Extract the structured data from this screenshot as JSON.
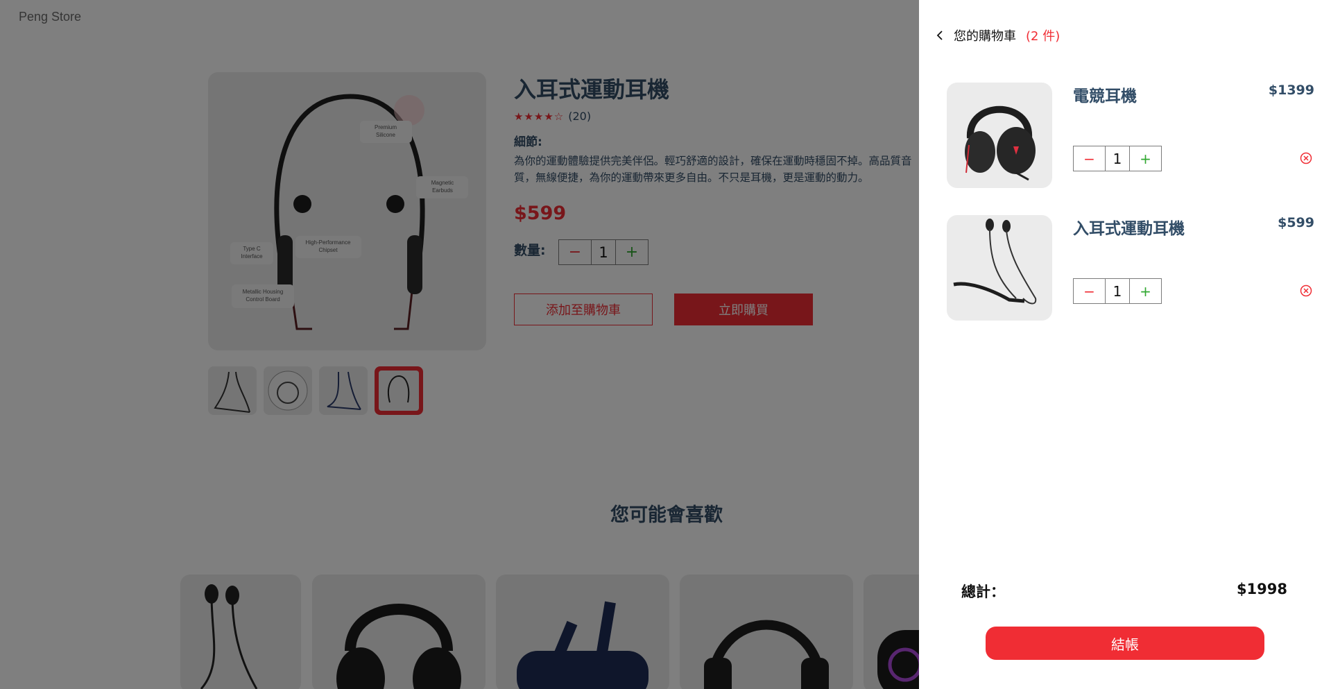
{
  "brand": "Peng Store",
  "product": {
    "title": "入耳式運動耳機",
    "rating_count": "(20)",
    "rating": 4,
    "details_heading": "細節:",
    "description": "為你的運動體驗提供完美伴侶。輕巧舒適的設計，確保在運動時穩固不掉。高品質音質，無線便捷，為你的運動帶來更多自由。不只是耳機，更是運動的動力。",
    "price": "$599",
    "quantity_label": "數量:",
    "quantity": "1",
    "add_to_cart": "添加至購物車",
    "buy_now": "立即購買",
    "image_callouts": [
      "Premium Silicone",
      "Magnetic Earbuds",
      "Type C Interface",
      "High-Performance Chipset",
      "Metallic Housing Control Board"
    ]
  },
  "recommendations_title": "您可能會喜歡",
  "cart": {
    "title": "您的購物車",
    "count": "(2 件)",
    "items": [
      {
        "name": "電競耳機",
        "price": "$1399",
        "quantity": "1"
      },
      {
        "name": "入耳式運動耳機",
        "price": "$599",
        "quantity": "1"
      }
    ],
    "total_label": "總計：",
    "total_value": "$1998",
    "checkout_label": "結帳"
  },
  "colors": {
    "accent": "#f02d34",
    "text": "#324d67",
    "plus": "#31a831",
    "tile": "#ebebeb"
  }
}
